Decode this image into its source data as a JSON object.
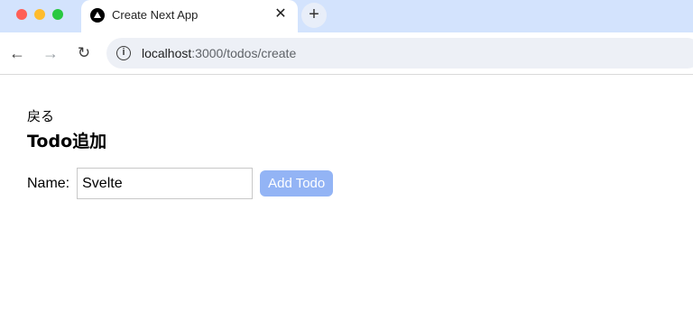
{
  "browser": {
    "tab": {
      "title": "Create Next App",
      "favicon_icon": "nextjs-triangle-icon",
      "close_symbol": "✕"
    },
    "new_tab_symbol": "+",
    "nav": {
      "back_symbol": "←",
      "forward_symbol": "→",
      "reload_symbol": "↻"
    },
    "address": {
      "info_symbol": "i",
      "host": "localhost",
      "path": ":3000/todos/create"
    }
  },
  "page": {
    "back_link": "戻る",
    "title": "Todo追加",
    "form": {
      "name_label": "Name:",
      "name_value": "Svelte",
      "submit_label": "Add Todo"
    }
  },
  "colors": {
    "chrome_bg": "#d3e3fd",
    "button_bg": "#93b4f5"
  }
}
